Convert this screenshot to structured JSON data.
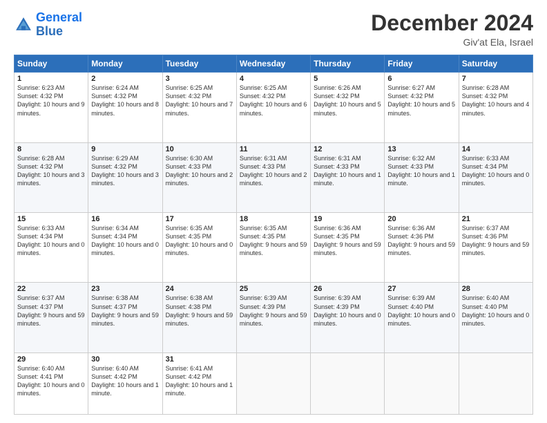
{
  "header": {
    "logo_line1": "General",
    "logo_line2": "Blue",
    "month": "December 2024",
    "location": "Giv'at Ela, Israel"
  },
  "days_of_week": [
    "Sunday",
    "Monday",
    "Tuesday",
    "Wednesday",
    "Thursday",
    "Friday",
    "Saturday"
  ],
  "weeks": [
    [
      {
        "day": "1",
        "sunrise": "Sunrise: 6:23 AM",
        "sunset": "Sunset: 4:32 PM",
        "daylight": "Daylight: 10 hours and 9 minutes."
      },
      {
        "day": "2",
        "sunrise": "Sunrise: 6:24 AM",
        "sunset": "Sunset: 4:32 PM",
        "daylight": "Daylight: 10 hours and 8 minutes."
      },
      {
        "day": "3",
        "sunrise": "Sunrise: 6:25 AM",
        "sunset": "Sunset: 4:32 PM",
        "daylight": "Daylight: 10 hours and 7 minutes."
      },
      {
        "day": "4",
        "sunrise": "Sunrise: 6:25 AM",
        "sunset": "Sunset: 4:32 PM",
        "daylight": "Daylight: 10 hours and 6 minutes."
      },
      {
        "day": "5",
        "sunrise": "Sunrise: 6:26 AM",
        "sunset": "Sunset: 4:32 PM",
        "daylight": "Daylight: 10 hours and 5 minutes."
      },
      {
        "day": "6",
        "sunrise": "Sunrise: 6:27 AM",
        "sunset": "Sunset: 4:32 PM",
        "daylight": "Daylight: 10 hours and 5 minutes."
      },
      {
        "day": "7",
        "sunrise": "Sunrise: 6:28 AM",
        "sunset": "Sunset: 4:32 PM",
        "daylight": "Daylight: 10 hours and 4 minutes."
      }
    ],
    [
      {
        "day": "8",
        "sunrise": "Sunrise: 6:28 AM",
        "sunset": "Sunset: 4:32 PM",
        "daylight": "Daylight: 10 hours and 3 minutes."
      },
      {
        "day": "9",
        "sunrise": "Sunrise: 6:29 AM",
        "sunset": "Sunset: 4:32 PM",
        "daylight": "Daylight: 10 hours and 3 minutes."
      },
      {
        "day": "10",
        "sunrise": "Sunrise: 6:30 AM",
        "sunset": "Sunset: 4:33 PM",
        "daylight": "Daylight: 10 hours and 2 minutes."
      },
      {
        "day": "11",
        "sunrise": "Sunrise: 6:31 AM",
        "sunset": "Sunset: 4:33 PM",
        "daylight": "Daylight: 10 hours and 2 minutes."
      },
      {
        "day": "12",
        "sunrise": "Sunrise: 6:31 AM",
        "sunset": "Sunset: 4:33 PM",
        "daylight": "Daylight: 10 hours and 1 minute."
      },
      {
        "day": "13",
        "sunrise": "Sunrise: 6:32 AM",
        "sunset": "Sunset: 4:33 PM",
        "daylight": "Daylight: 10 hours and 1 minute."
      },
      {
        "day": "14",
        "sunrise": "Sunrise: 6:33 AM",
        "sunset": "Sunset: 4:34 PM",
        "daylight": "Daylight: 10 hours and 0 minutes."
      }
    ],
    [
      {
        "day": "15",
        "sunrise": "Sunrise: 6:33 AM",
        "sunset": "Sunset: 4:34 PM",
        "daylight": "Daylight: 10 hours and 0 minutes."
      },
      {
        "day": "16",
        "sunrise": "Sunrise: 6:34 AM",
        "sunset": "Sunset: 4:34 PM",
        "daylight": "Daylight: 10 hours and 0 minutes."
      },
      {
        "day": "17",
        "sunrise": "Sunrise: 6:35 AM",
        "sunset": "Sunset: 4:35 PM",
        "daylight": "Daylight: 10 hours and 0 minutes."
      },
      {
        "day": "18",
        "sunrise": "Sunrise: 6:35 AM",
        "sunset": "Sunset: 4:35 PM",
        "daylight": "Daylight: 9 hours and 59 minutes."
      },
      {
        "day": "19",
        "sunrise": "Sunrise: 6:36 AM",
        "sunset": "Sunset: 4:35 PM",
        "daylight": "Daylight: 9 hours and 59 minutes."
      },
      {
        "day": "20",
        "sunrise": "Sunrise: 6:36 AM",
        "sunset": "Sunset: 4:36 PM",
        "daylight": "Daylight: 9 hours and 59 minutes."
      },
      {
        "day": "21",
        "sunrise": "Sunrise: 6:37 AM",
        "sunset": "Sunset: 4:36 PM",
        "daylight": "Daylight: 9 hours and 59 minutes."
      }
    ],
    [
      {
        "day": "22",
        "sunrise": "Sunrise: 6:37 AM",
        "sunset": "Sunset: 4:37 PM",
        "daylight": "Daylight: 9 hours and 59 minutes."
      },
      {
        "day": "23",
        "sunrise": "Sunrise: 6:38 AM",
        "sunset": "Sunset: 4:37 PM",
        "daylight": "Daylight: 9 hours and 59 minutes."
      },
      {
        "day": "24",
        "sunrise": "Sunrise: 6:38 AM",
        "sunset": "Sunset: 4:38 PM",
        "daylight": "Daylight: 9 hours and 59 minutes."
      },
      {
        "day": "25",
        "sunrise": "Sunrise: 6:39 AM",
        "sunset": "Sunset: 4:39 PM",
        "daylight": "Daylight: 9 hours and 59 minutes."
      },
      {
        "day": "26",
        "sunrise": "Sunrise: 6:39 AM",
        "sunset": "Sunset: 4:39 PM",
        "daylight": "Daylight: 10 hours and 0 minutes."
      },
      {
        "day": "27",
        "sunrise": "Sunrise: 6:39 AM",
        "sunset": "Sunset: 4:40 PM",
        "daylight": "Daylight: 10 hours and 0 minutes."
      },
      {
        "day": "28",
        "sunrise": "Sunrise: 6:40 AM",
        "sunset": "Sunset: 4:40 PM",
        "daylight": "Daylight: 10 hours and 0 minutes."
      }
    ],
    [
      {
        "day": "29",
        "sunrise": "Sunrise: 6:40 AM",
        "sunset": "Sunset: 4:41 PM",
        "daylight": "Daylight: 10 hours and 0 minutes."
      },
      {
        "day": "30",
        "sunrise": "Sunrise: 6:40 AM",
        "sunset": "Sunset: 4:42 PM",
        "daylight": "Daylight: 10 hours and 1 minute."
      },
      {
        "day": "31",
        "sunrise": "Sunrise: 6:41 AM",
        "sunset": "Sunset: 4:42 PM",
        "daylight": "Daylight: 10 hours and 1 minute."
      },
      null,
      null,
      null,
      null
    ]
  ]
}
